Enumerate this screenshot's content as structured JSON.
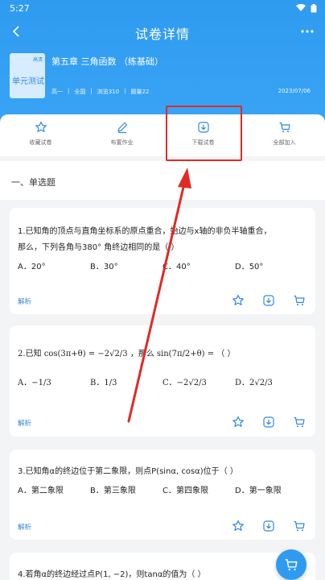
{
  "status_bar": {
    "time": "5:27"
  },
  "nav": {
    "title": "试卷详情"
  },
  "paper": {
    "cover_badge": "高清",
    "cover_text": "单元测试",
    "title": "第五章 三角函数 （练基础）",
    "meta": [
      "高一",
      "全国",
      "浏览310",
      "题量22"
    ],
    "date": "2023/07/06"
  },
  "actions": [
    {
      "label": "收藏试卷",
      "icon": "star-icon"
    },
    {
      "label": "布置作业",
      "icon": "pen-icon"
    },
    {
      "label": "下载试卷",
      "icon": "download-icon"
    },
    {
      "label": "全部加入",
      "icon": "cart-icon"
    }
  ],
  "section": {
    "title": "一、单选题"
  },
  "questions": [
    {
      "line1": "1.已知角的顶点与直角坐标系的原点重合，始边与x轴的非负半轴重合，",
      "line2": "那么，下列各角与380° 角终边相同的是（    ）",
      "options": [
        "A．20°",
        "B．30°",
        "C．40°",
        "D．50°"
      ],
      "analysis": "解析"
    },
    {
      "line1": "2.已知 cos(3π+θ) = −2√2/3 ，那么 sin(7π/2+θ) = （    ）",
      "options": [
        "A．−1/3",
        "B．1/3",
        "C．−2√2/3",
        "D．2√2/3"
      ],
      "analysis": "解析"
    },
    {
      "line1": "3.已知角α的终边位于第二象限，则点P(sinα, cosα)位于（    ）",
      "options": [
        "A．第二象限",
        "B．第三象限",
        "C．第四象限",
        "D．第一象限"
      ],
      "analysis": "解析"
    },
    {
      "line1": "4.若角α的终边经过点P(1, −2)，则tanα的值为（    ）"
    }
  ],
  "colors": {
    "primary": "#2f9bf0",
    "link": "#2f88de",
    "highlight": "#e02a25"
  }
}
